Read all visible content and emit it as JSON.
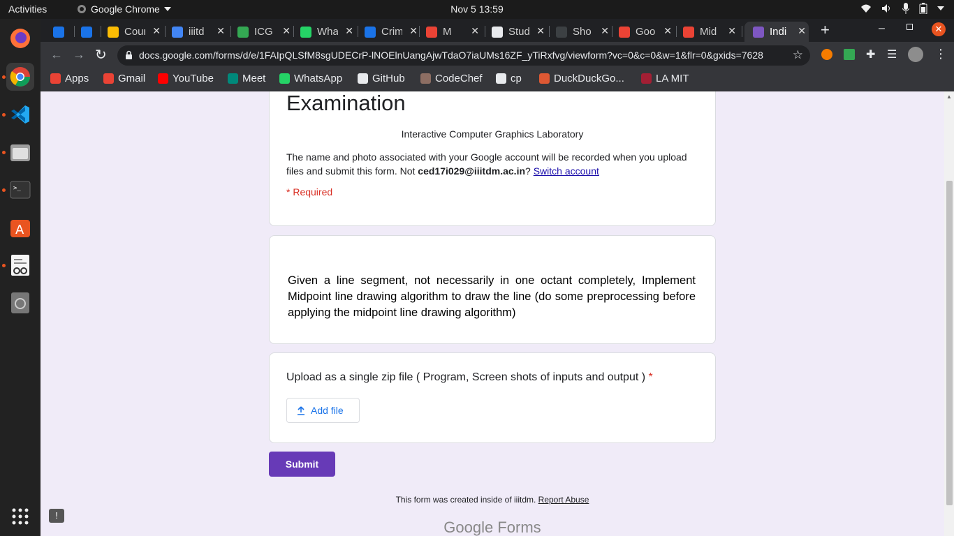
{
  "system": {
    "activities": "Activities",
    "app_name": "Google Chrome",
    "clock": "Nov 5  13:59"
  },
  "tabs": [
    {
      "label": "",
      "color": "#1a73e8"
    },
    {
      "label": "",
      "color": "#1a73e8"
    },
    {
      "label": "Cour",
      "color": "#fbbc04"
    },
    {
      "label": "iiitd",
      "color": "#4285f4"
    },
    {
      "label": "ICG",
      "color": "#34a853"
    },
    {
      "label": "Wha",
      "color": "#25d366"
    },
    {
      "label": "Crim",
      "color": "#1a73e8"
    },
    {
      "label": "M",
      "color": "#ea4335"
    },
    {
      "label": "Stud",
      "color": "#e8eaed"
    },
    {
      "label": "Sho",
      "color": "#3c4043"
    },
    {
      "label": "Goo",
      "color": "#ea4335"
    },
    {
      "label": "Mid",
      "color": "#ea4335"
    },
    {
      "label": "Indi",
      "color": "#7e57c2"
    }
  ],
  "omnibox": {
    "url": "docs.google.com/forms/d/e/1FAIpQLSfM8sgUDECrP-lNOElnUangAjwTdaO7iaUMs16ZF_yTiRxfvg/viewform?vc=0&c=0&w=1&flr=0&gxids=7628"
  },
  "bookmarks": [
    {
      "label": "Apps",
      "color": "#ea4335"
    },
    {
      "label": "Gmail",
      "color": "#ea4335"
    },
    {
      "label": "YouTube",
      "color": "#ff0000"
    },
    {
      "label": "Meet",
      "color": "#00897b"
    },
    {
      "label": "WhatsApp",
      "color": "#25d366"
    },
    {
      "label": "GitHub",
      "color": "#e8eaed"
    },
    {
      "label": "CodeChef",
      "color": "#8d6e63"
    },
    {
      "label": "cp",
      "color": "#e8eaed"
    },
    {
      "label": "DuckDuckGo...",
      "color": "#de5833"
    },
    {
      "label": "LA MIT",
      "color": "#a31f34"
    }
  ],
  "form": {
    "title": "Examination",
    "subtitle": "Interactive Computer Graphics Laboratory",
    "notice_prefix": "The name and photo associated with your Google account will be recorded when you upload files and submit this form. Not ",
    "account": "ced17i029@iiitdm.ac.in",
    "notice_q": "? ",
    "switch_account": "Switch account",
    "required": "* Required",
    "question": "Given a line segment, not necessarily in one octant completely,   Implement Midpoint line drawing algorithm to draw the line (do some preprocessing before applying the midpoint line drawing algorithm)",
    "upload_label": "Upload as a single zip file ( Program, Screen shots of inputs and output ) ",
    "upload_required": "*",
    "add_file": "Add file",
    "submit": "Submit",
    "footer": "This form was created inside of iiitdm. ",
    "report": "Report Abuse",
    "brand": "Google Forms"
  },
  "colors": {
    "accent": "#673ab7",
    "required": "#d93025",
    "link": "#1a73e8",
    "page_bg": "#f0ebf8"
  }
}
